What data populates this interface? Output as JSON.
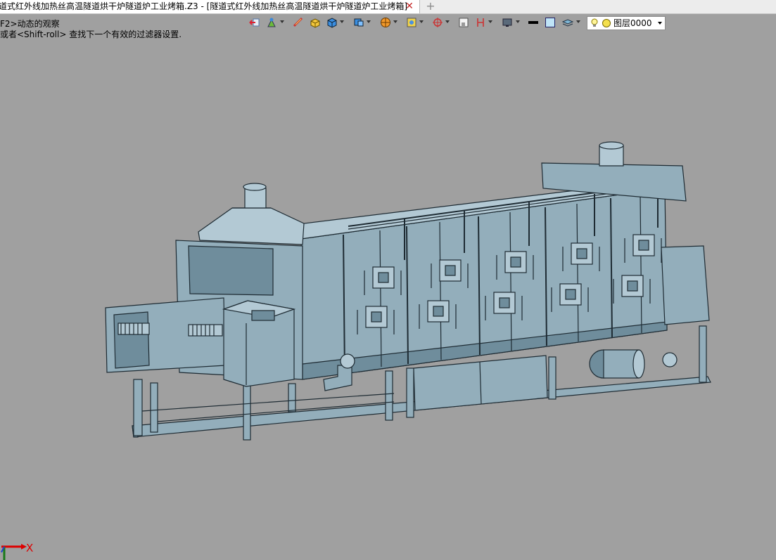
{
  "window": {
    "tab_title": "道式红外线加热丝高温隧道烘干炉隧道炉工业烤箱.Z3 - [隧道式红外线加热丝高温隧道烘干炉隧道炉工业烤箱]",
    "close_glyph": "✕",
    "add_glyph": "+"
  },
  "hints": {
    "line1": "F2>动态的观察",
    "line2": "或者<Shift-roll> 查找下一个有效的过滤器设置."
  },
  "toolbar": {
    "icons": [
      "back-icon",
      "paint-icon",
      "ruler-icon",
      "box-solid-icon",
      "cube-icon",
      "views-icon",
      "sphere-icon",
      "shade-icon",
      "pivot-icon",
      "fit-icon",
      "bracket-icon",
      "display-icon",
      "line-color-icon",
      "face-color-icon",
      "layer-icon"
    ],
    "accent": "#1e6fd8"
  },
  "layer": {
    "name": "图层0000"
  },
  "axis": {
    "x_label": "X"
  },
  "colors": {
    "background": "#a0a0a0",
    "model_fill": "#93aebb",
    "model_dark": "#6f8d9c",
    "model_light": "#b3c9d4",
    "model_stroke": "#1e2b33"
  }
}
